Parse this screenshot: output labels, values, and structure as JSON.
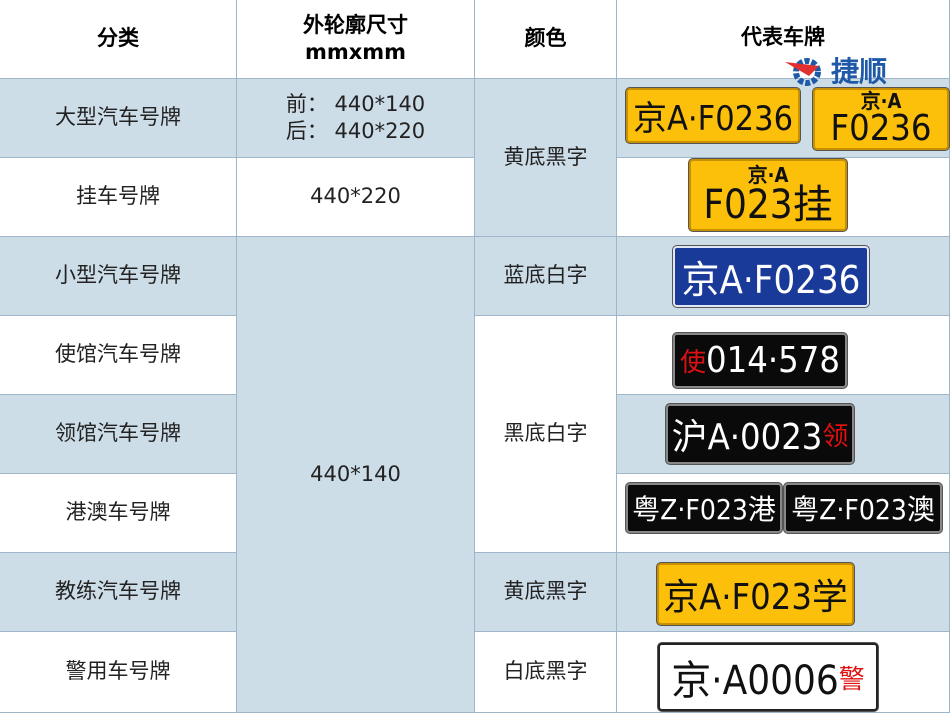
{
  "header": {
    "category": "分类",
    "size": "外轮廓尺寸",
    "size_unit": "mmxmm",
    "color": "颜色",
    "plate": "代表车牌"
  },
  "logo": {
    "text": "捷顺",
    "icon": "gear-logo-icon"
  },
  "rows": [
    {
      "category": "大型汽车号牌",
      "size_front": "前：  440*140",
      "size_back": "后：  440*220"
    },
    {
      "category": "挂车号牌",
      "size": "440*220"
    },
    {
      "category": "小型汽车号牌"
    },
    {
      "category": "使馆汽车号牌"
    },
    {
      "category": "领馆汽车号牌"
    },
    {
      "category": "港澳车号牌"
    },
    {
      "category": "教练汽车号牌"
    },
    {
      "category": "警用车号牌"
    }
  ],
  "merged": {
    "size_small": "440*140",
    "color_yellow_top": "黄底黑字",
    "color_blue": "蓝底白字",
    "color_black": "黑底白字",
    "color_yellow_coach": "黄底黑字",
    "color_white": "白底黑字"
  },
  "plates": {
    "large_front": "京A·F0236",
    "large_back_top": "京·A",
    "large_back_bottom": "F0236",
    "trailer_top": "京·A",
    "trailer_bottom": "F023挂",
    "small": "京A·F0236",
    "embassy_prefix": "使",
    "embassy": "014·578",
    "consulate": "沪A·0023",
    "consulate_suffix": "领",
    "hk": "粤Z·F023港",
    "macau": "粤Z·F023澳",
    "coach": "京A·F023学",
    "police": "京·A0006",
    "police_suffix": "警"
  },
  "colors": {
    "row_blue": "#cddde8",
    "plate_yellow": "#fcc00a",
    "plate_blue": "#1a3a9a",
    "plate_black": "#0a0a0a"
  }
}
